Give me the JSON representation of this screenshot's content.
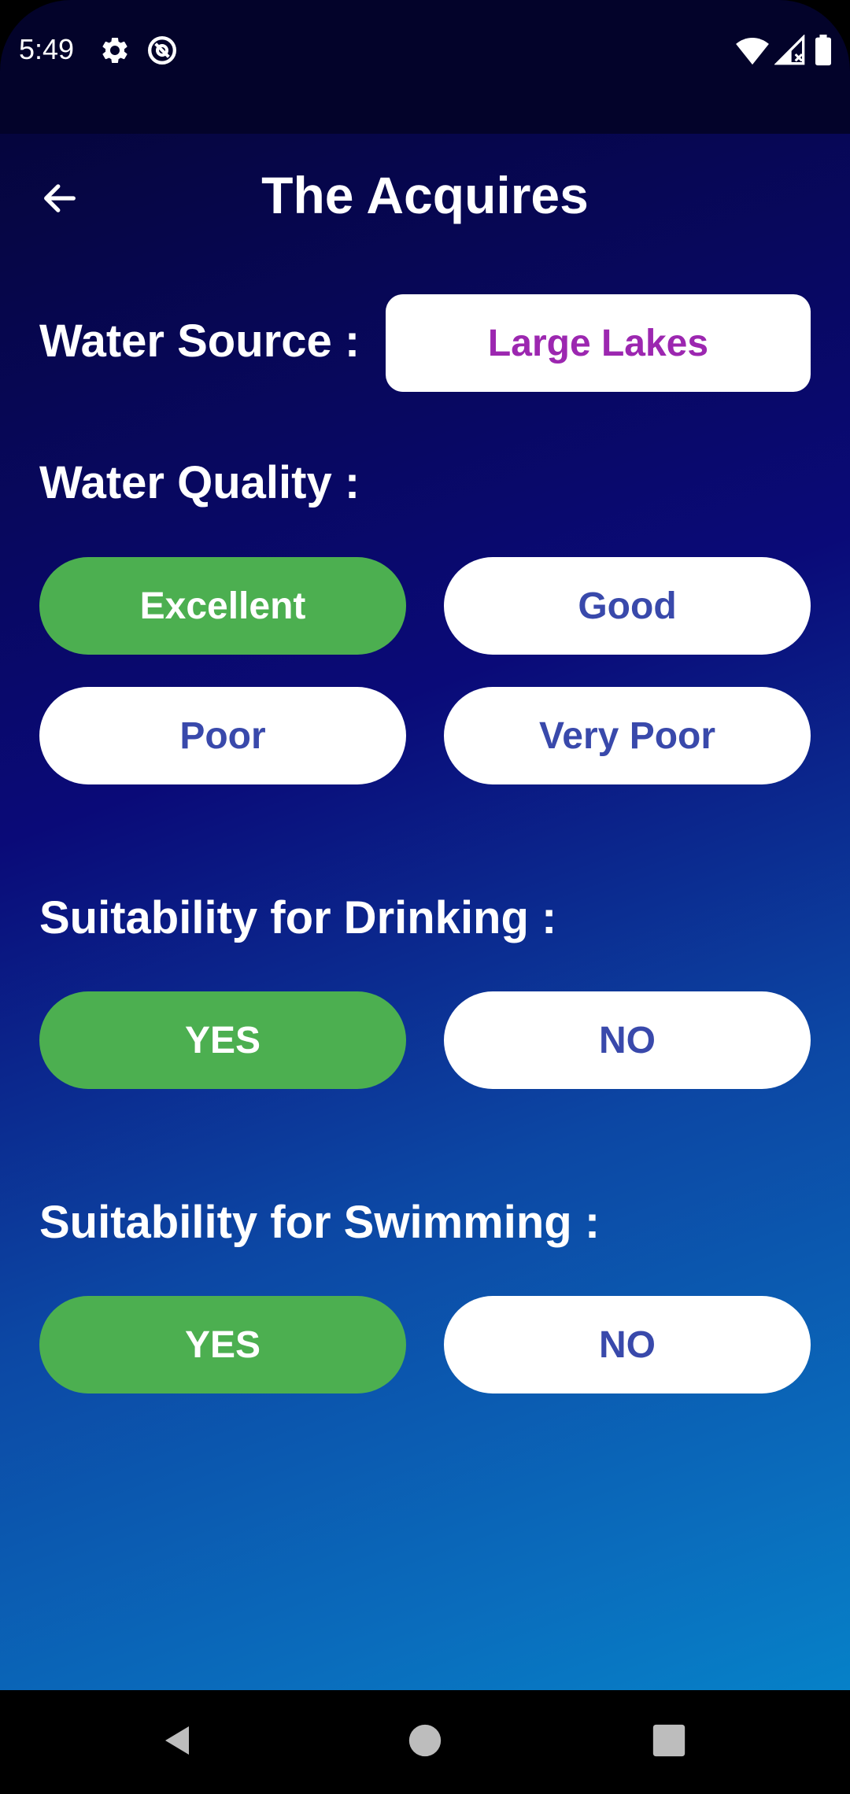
{
  "status_bar": {
    "time": "5:49",
    "icons_left": [
      "gear-icon",
      "at-sign-icon"
    ],
    "icons_right": [
      "wifi-icon",
      "signal-icon",
      "battery-icon"
    ]
  },
  "header": {
    "title": "The Acquires",
    "back_icon": "arrow-left-icon"
  },
  "water_source": {
    "label": "Water Source :",
    "value": "Large Lakes"
  },
  "water_quality": {
    "label": "Water Quality :",
    "options": [
      "Excellent",
      "Good",
      "Poor",
      "Very Poor"
    ],
    "selected": "Excellent"
  },
  "drinking": {
    "label": "Suitability for Drinking :",
    "yes": "YES",
    "no": "NO",
    "selected": "YES"
  },
  "swimming": {
    "label": "Suitability for Swimming :",
    "yes": "YES",
    "no": "NO",
    "selected": "YES"
  },
  "nav_bar": {
    "icons": [
      "back-triangle-icon",
      "home-circle-icon",
      "recents-square-icon"
    ]
  },
  "colors": {
    "selected": "#4caf50",
    "unselected_text": "#3949ab",
    "source_text": "#9c27b0"
  }
}
